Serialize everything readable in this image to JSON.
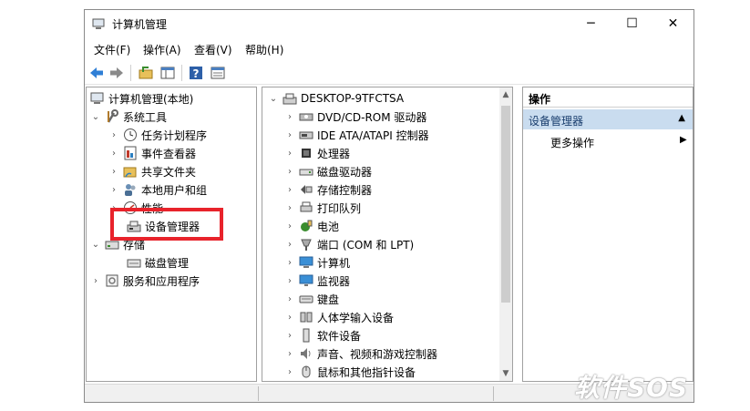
{
  "window": {
    "title": "计算机管理"
  },
  "menu": [
    "文件(F)",
    "操作(A)",
    "查看(V)",
    "帮助(H)"
  ],
  "tree": {
    "root": "计算机管理(本地)",
    "system_tools": "系统工具",
    "task_scheduler": "任务计划程序",
    "event_viewer": "事件查看器",
    "shared_folders": "共享文件夹",
    "local_users": "本地用户和组",
    "performance": "性能",
    "device_manager": "设备管理器",
    "storage": "存储",
    "disk_management": "磁盘管理",
    "services": "服务和应用程序"
  },
  "devices": {
    "root": "DESKTOP-9TFCTSA",
    "items": [
      "DVD/CD-ROM 驱动器",
      "IDE ATA/ATAPI 控制器",
      "处理器",
      "磁盘驱动器",
      "存储控制器",
      "打印队列",
      "电池",
      "端口 (COM 和 LPT)",
      "计算机",
      "监视器",
      "键盘",
      "人体学输入设备",
      "软件设备",
      "声音、视频和游戏控制器",
      "鼠标和其他指针设备"
    ]
  },
  "actions": {
    "header": "操作",
    "section": "设备管理器",
    "more": "更多操作"
  },
  "watermark": "软件SOS",
  "colors": {
    "highlight": "#e8232b",
    "selection": "#c9dcef"
  }
}
